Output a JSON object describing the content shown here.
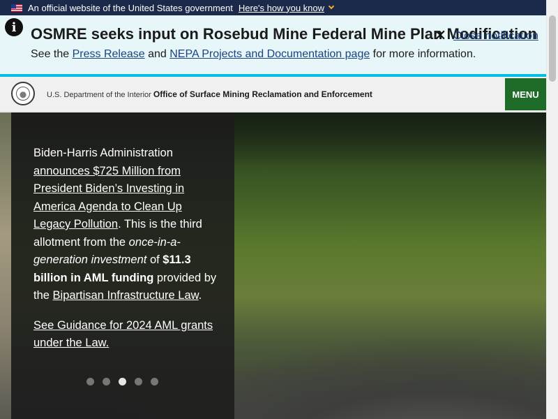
{
  "gov_banner": {
    "text": "An official website of the United States government",
    "link": "Here's how you know"
  },
  "alert": {
    "title": "OSMRE seeks input on Rosebud Mine Federal Mine Plan Modification",
    "body_prefix": "See the ",
    "link1": "Press Release",
    "body_mid": " and ",
    "link2": "NEPA Projects and Documentation page",
    "body_suffix": " for more information.",
    "close_label": "Close notification"
  },
  "header": {
    "department": "U.S. Department of the Interior",
    "office": "Office of Surface Mining Reclamation and Enforcement",
    "menu_label": "MENU"
  },
  "hero": {
    "caption": {
      "line1": "Biden-Harris Administration ",
      "link1": "announces $725 Million from President Biden’s Investing in America Agenda to Clean Up Legacy Pollution",
      "text1": ". This is the third allotment from the ",
      "emph": "once-in-a-generation investment",
      "text2": " of ",
      "strong": "$11.3 billion in AML funding",
      "text3": " provided by the ",
      "link2": "Bipartisan Infrastructure Law",
      "text4": ".",
      "link3": "See Guidance for 2024 AML grants under the Law."
    },
    "slides": {
      "count": 5,
      "active_index": 2
    }
  },
  "colors": {
    "gov_banner_bg": "#1b2a4a",
    "alert_bg": "#e7f6f8",
    "alert_border": "#00bde3",
    "menu_bg": "#1e6b2a",
    "link": "#1a4480"
  }
}
